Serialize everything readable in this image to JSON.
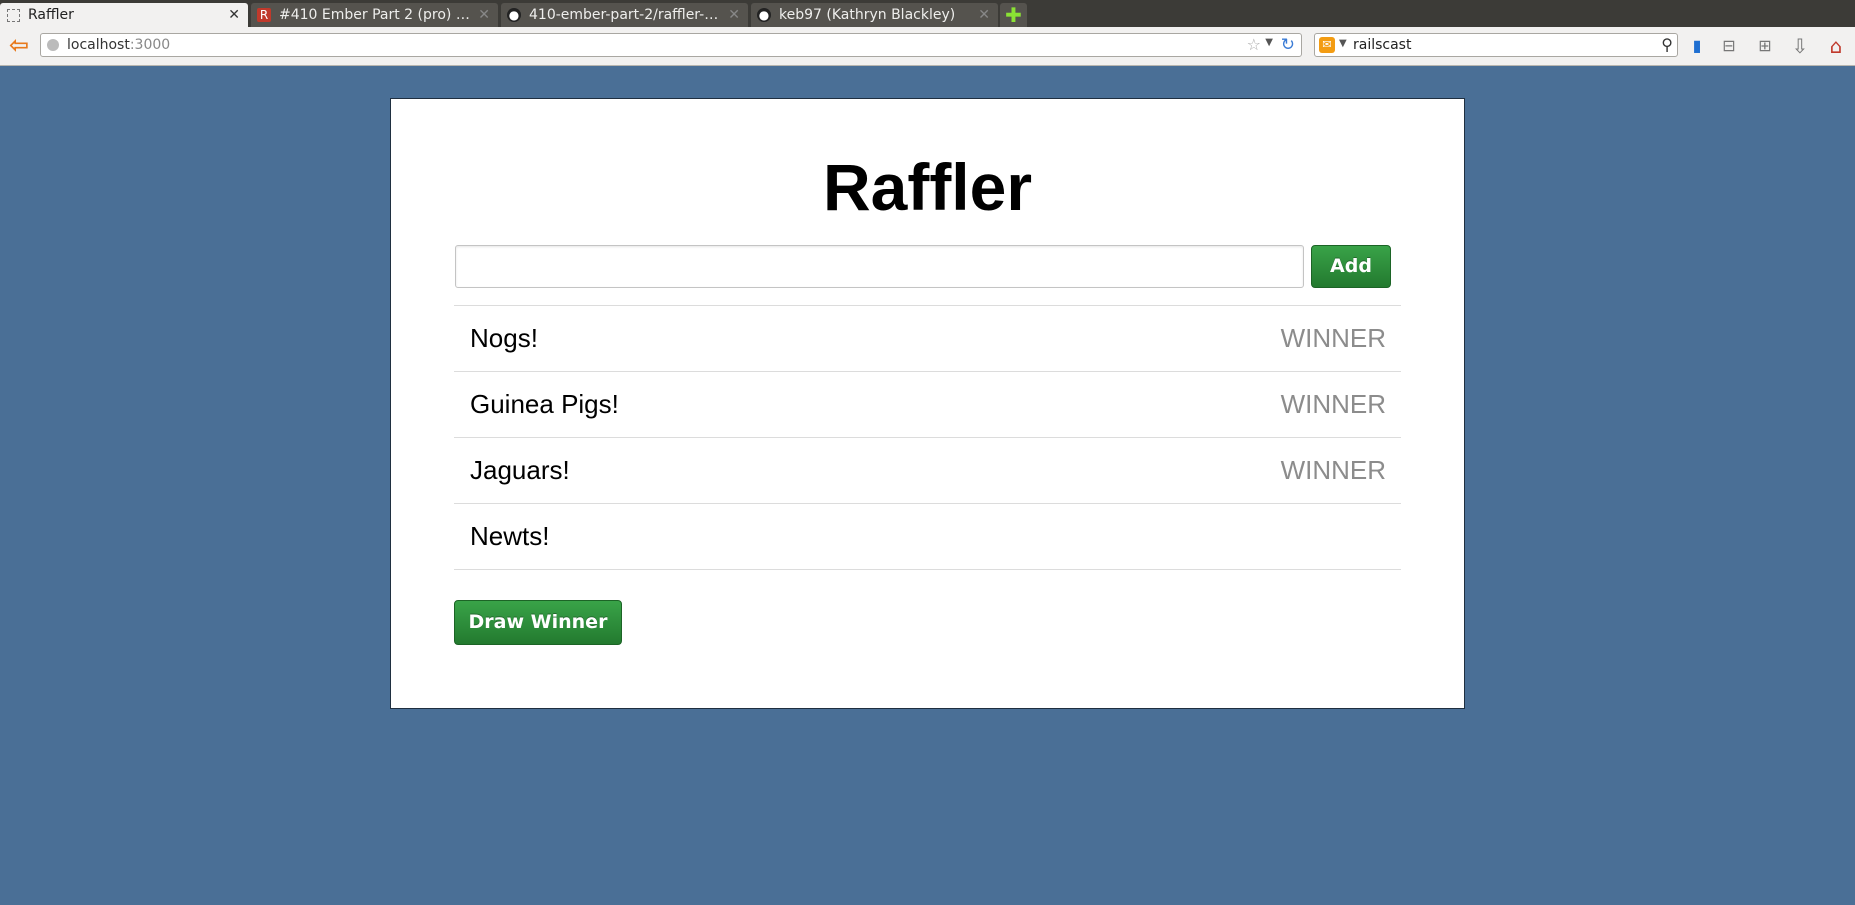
{
  "browser": {
    "tabs": [
      {
        "title": "Raffler",
        "active": true,
        "icon": "page-icon"
      },
      {
        "title": "#410 Ember Part 2 (pro) - RailsCasts",
        "active": false,
        "icon": "railscasts-icon"
      },
      {
        "title": "410-ember-part-2/raffler-after",
        "active": false,
        "icon": "github-icon"
      },
      {
        "title": "keb97 (Kathryn Blackley)",
        "active": false,
        "icon": "github-icon"
      }
    ],
    "address": {
      "host": "localhost",
      "port": ":3000"
    },
    "search": {
      "query": "railscast"
    }
  },
  "page": {
    "title": "Raffler",
    "entry_input": {
      "value": "",
      "placeholder": ""
    },
    "add_label": "Add",
    "entries": [
      {
        "name": "Nogs!",
        "winner_label": "WINNER"
      },
      {
        "name": "Guinea Pigs!",
        "winner_label": "WINNER"
      },
      {
        "name": "Jaguars!",
        "winner_label": "WINNER"
      },
      {
        "name": "Newts!",
        "winner_label": ""
      }
    ],
    "draw_label": "Draw Winner"
  },
  "colors": {
    "background": "#4a6f96",
    "button_green": "#2d8f3b",
    "winner_gray": "#8c8c8c"
  }
}
